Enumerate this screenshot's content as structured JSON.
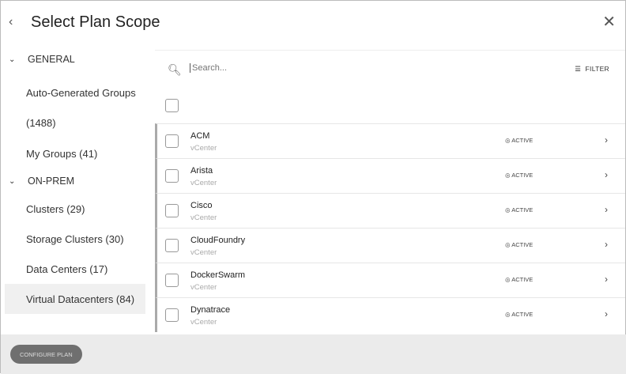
{
  "header": {
    "title": "Select Plan Scope",
    "back_icon": "‹",
    "close_icon": "✕"
  },
  "sidebar": {
    "sections": [
      {
        "label": "GENERAL"
      },
      {
        "label": "ON-PREM"
      }
    ],
    "general_items": [
      "Auto-Generated Groups (1488)",
      "My Groups (41)"
    ],
    "onprem_items": [
      "Clusters (29)",
      "Storage Clusters (30)",
      "Data Centers (17)",
      "Virtual Datacenters (84)"
    ]
  },
  "search": {
    "placeholder": "Search...",
    "filter_label": "FILTER"
  },
  "rows": [
    {
      "name": "ACM",
      "type": "vCenter",
      "status": "ACTIVE"
    },
    {
      "name": "Arista",
      "type": "vCenter",
      "status": "ACTIVE"
    },
    {
      "name": "Cisco",
      "type": "vCenter",
      "status": "ACTIVE"
    },
    {
      "name": "CloudFoundry",
      "type": "vCenter",
      "status": "ACTIVE"
    },
    {
      "name": "DockerSwarm",
      "type": "vCenter",
      "status": "ACTIVE"
    },
    {
      "name": "Dynatrace",
      "type": "vCenter",
      "status": "ACTIVE"
    }
  ],
  "footer": {
    "configure_label": "CONFIGURE PLAN"
  }
}
